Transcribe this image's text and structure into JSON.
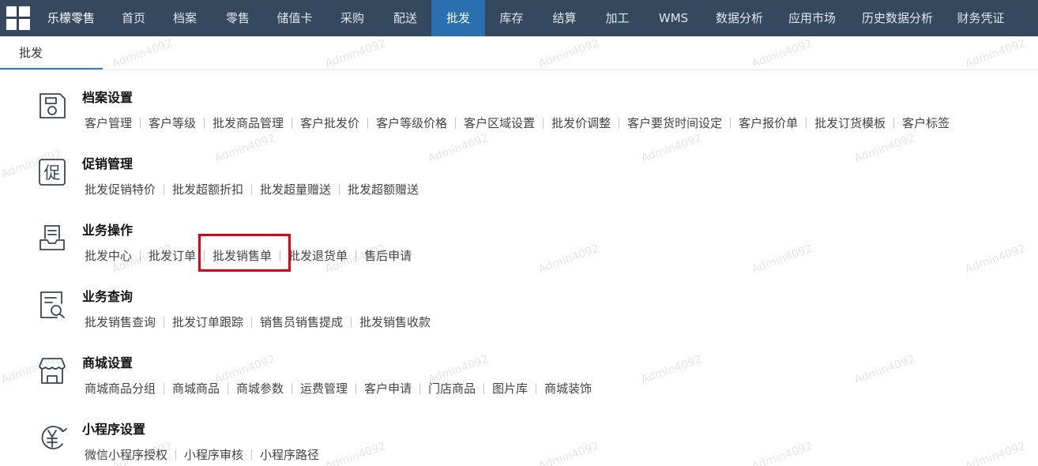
{
  "brand": "乐檬零售",
  "nav": [
    "首页",
    "档案",
    "零售",
    "储值卡",
    "采购",
    "配送",
    "批发",
    "库存",
    "结算",
    "加工",
    "WMS",
    "数据分析",
    "应用市场",
    "历史数据分析",
    "财务凭证"
  ],
  "active_nav": "批发",
  "subtab": "批发",
  "watermark": "Admin4092",
  "highlight_color": "#e60012",
  "highlighted_link": "批发销售单",
  "sections": [
    {
      "icon": "archive-settings-icon",
      "title": "档案设置",
      "links": [
        "客户管理",
        "客户等级",
        "批发商品管理",
        "客户批发价",
        "客户等级价格",
        "客户区域设置",
        "批发价调整",
        "客户要货时间设定",
        "客户报价单",
        "批发订货模板",
        "客户标签"
      ]
    },
    {
      "icon": "promotion-icon",
      "title": "促销管理",
      "links": [
        "批发促销特价",
        "批发超额折扣",
        "批发超量赠送",
        "批发超额赠送"
      ]
    },
    {
      "icon": "business-operation-icon",
      "title": "业务操作",
      "links": [
        "批发中心",
        "批发订单",
        "批发销售单",
        "批发退货单",
        "售后申请"
      ]
    },
    {
      "icon": "business-query-icon",
      "title": "业务查询",
      "links": [
        "批发销售查询",
        "批发订单跟踪",
        "销售员销售提成",
        "批发销售收款"
      ]
    },
    {
      "icon": "store-icon",
      "title": "商城设置",
      "links": [
        "商城商品分组",
        "商城商品",
        "商城参数",
        "运费管理",
        "客户申请",
        "门店商品",
        "图片库",
        "商城装饰"
      ]
    },
    {
      "icon": "yuan-icon",
      "title": "小程序设置",
      "links": [
        "微信小程序授权",
        "小程序审核",
        "小程序路径"
      ]
    }
  ]
}
